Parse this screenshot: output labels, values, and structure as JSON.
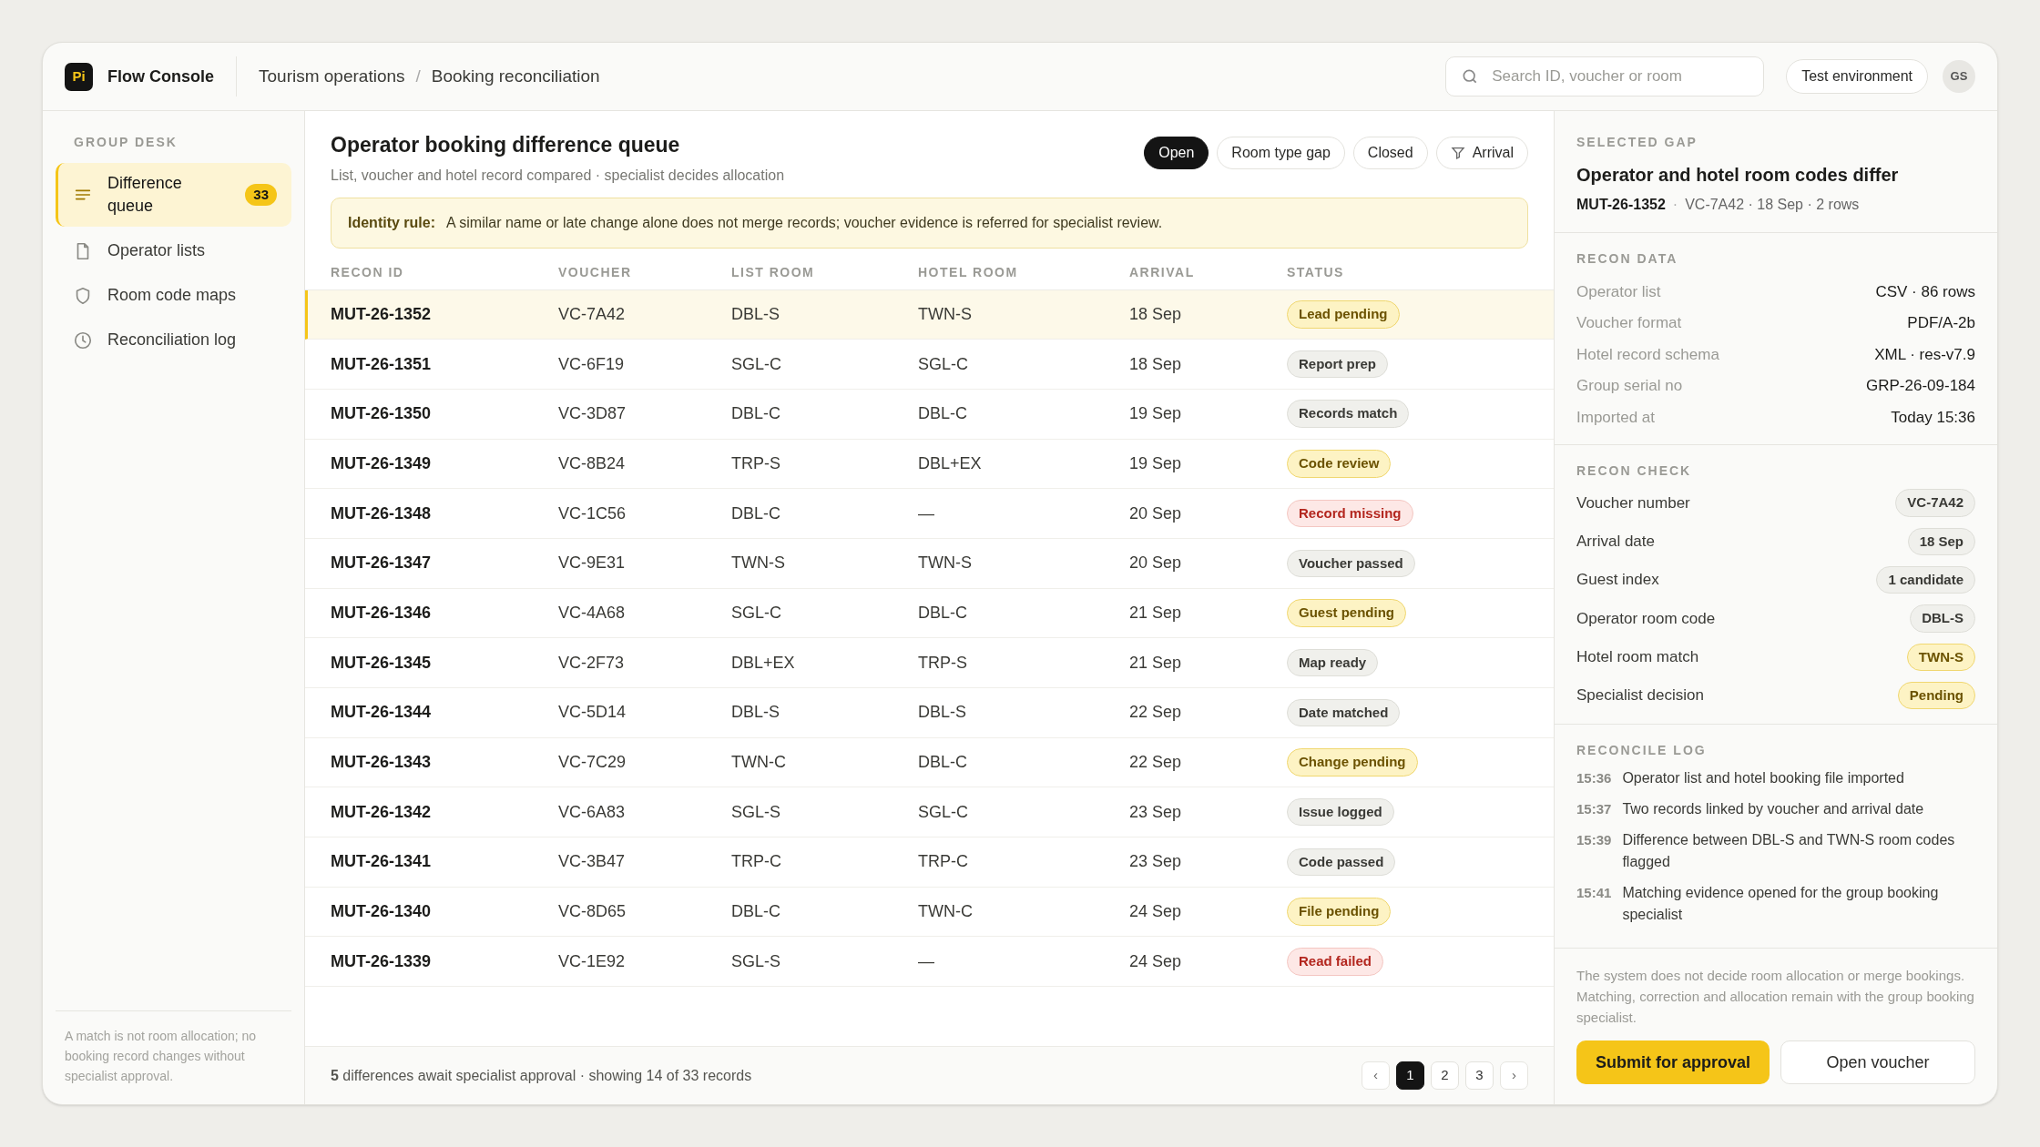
{
  "app": {
    "logo": "Pi",
    "name": "Flow Console"
  },
  "breadcrumb": {
    "items": [
      "Tourism operations",
      "Booking reconciliation"
    ],
    "separator": "/"
  },
  "search": {
    "placeholder": "Search ID, voucher or room"
  },
  "environment": "Test environment",
  "user": {
    "initials": "GS"
  },
  "sidebar": {
    "heading": "GROUP DESK",
    "items": [
      {
        "label": "Difference queue",
        "kind": "lines",
        "badge": "33",
        "selected": true
      },
      {
        "label": "Operator lists",
        "kind": "file",
        "selected": false
      },
      {
        "label": "Room code maps",
        "kind": "shield",
        "selected": false
      },
      {
        "label": "Reconciliation log",
        "kind": "clock",
        "selected": false
      }
    ],
    "note": "A match is not room allocation; no booking record changes without specialist approval."
  },
  "queue": {
    "title": "Operator booking difference queue",
    "subtitle": "List, voucher and hotel record compared · specialist decides allocation",
    "filters": [
      {
        "label": "Open",
        "selected": true
      },
      {
        "label": "Room type gap",
        "selected": false
      },
      {
        "label": "Closed",
        "selected": false
      },
      {
        "label": "Arrival",
        "selected": false,
        "kind": "filter"
      }
    ],
    "rule": {
      "label": "Identity rule:",
      "text": "A similar name or late change alone does not merge records; voucher evidence is referred for specialist review."
    },
    "columns": [
      "RECON ID",
      "VOUCHER",
      "LIST ROOM",
      "HOTEL ROOM",
      "ARRIVAL",
      "STATUS"
    ],
    "rows": [
      {
        "id": "MUT-26-1352",
        "voucher": "VC-7A42",
        "list_room": "DBL-S",
        "hotel_room": "TWN-S",
        "arrival": "18 Sep",
        "status": "Lead pending",
        "kind": "pending",
        "selected": true
      },
      {
        "id": "MUT-26-1351",
        "voucher": "VC-6F19",
        "list_room": "SGL-C",
        "hotel_room": "SGL-C",
        "arrival": "18 Sep",
        "status": "Report prep",
        "kind": "neutral",
        "selected": false
      },
      {
        "id": "MUT-26-1350",
        "voucher": "VC-3D87",
        "list_room": "DBL-C",
        "hotel_room": "DBL-C",
        "arrival": "19 Sep",
        "status": "Records match",
        "kind": "neutral",
        "selected": false
      },
      {
        "id": "MUT-26-1349",
        "voucher": "VC-8B24",
        "list_room": "TRP-S",
        "hotel_room": "DBL+EX",
        "arrival": "19 Sep",
        "status": "Code review",
        "kind": "pending",
        "selected": false
      },
      {
        "id": "MUT-26-1348",
        "voucher": "VC-1C56",
        "list_room": "DBL-C",
        "hotel_room": "—",
        "arrival": "20 Sep",
        "status": "Record missing",
        "kind": "error",
        "selected": false
      },
      {
        "id": "MUT-26-1347",
        "voucher": "VC-9E31",
        "list_room": "TWN-S",
        "hotel_room": "TWN-S",
        "arrival": "20 Sep",
        "status": "Voucher passed",
        "kind": "neutral",
        "selected": false
      },
      {
        "id": "MUT-26-1346",
        "voucher": "VC-4A68",
        "list_room": "SGL-C",
        "hotel_room": "DBL-C",
        "arrival": "21 Sep",
        "status": "Guest pending",
        "kind": "pending",
        "selected": false
      },
      {
        "id": "MUT-26-1345",
        "voucher": "VC-2F73",
        "list_room": "DBL+EX",
        "hotel_room": "TRP-S",
        "arrival": "21 Sep",
        "status": "Map ready",
        "kind": "neutral",
        "selected": false
      },
      {
        "id": "MUT-26-1344",
        "voucher": "VC-5D14",
        "list_room": "DBL-S",
        "hotel_room": "DBL-S",
        "arrival": "22 Sep",
        "status": "Date matched",
        "kind": "neutral",
        "selected": false
      },
      {
        "id": "MUT-26-1343",
        "voucher": "VC-7C29",
        "list_room": "TWN-C",
        "hotel_room": "DBL-C",
        "arrival": "22 Sep",
        "status": "Change pending",
        "kind": "pending",
        "selected": false
      },
      {
        "id": "MUT-26-1342",
        "voucher": "VC-6A83",
        "list_room": "SGL-S",
        "hotel_room": "SGL-C",
        "arrival": "23 Sep",
        "status": "Issue logged",
        "kind": "neutral",
        "selected": false
      },
      {
        "id": "MUT-26-1341",
        "voucher": "VC-3B47",
        "list_room": "TRP-C",
        "hotel_room": "TRP-C",
        "arrival": "23 Sep",
        "status": "Code passed",
        "kind": "neutral",
        "selected": false
      },
      {
        "id": "MUT-26-1340",
        "voucher": "VC-8D65",
        "list_room": "DBL-C",
        "hotel_room": "TWN-C",
        "arrival": "24 Sep",
        "status": "File pending",
        "kind": "pending",
        "selected": false
      },
      {
        "id": "MUT-26-1339",
        "voucher": "VC-1E92",
        "list_room": "SGL-S",
        "hotel_room": "—",
        "arrival": "24 Sep",
        "status": "Read failed",
        "kind": "error",
        "selected": false
      }
    ],
    "footer": "**5** differences await specialist approval · showing 14 of 33 records",
    "pages": [
      {
        "label": "‹",
        "kind": "arrow",
        "selected": false
      },
      {
        "label": "1",
        "kind": "page",
        "selected": true
      },
      {
        "label": "2",
        "kind": "page",
        "selected": false
      },
      {
        "label": "3",
        "kind": "page",
        "selected": false
      },
      {
        "label": "›",
        "kind": "arrow",
        "selected": false
      }
    ]
  },
  "detail": {
    "heading": "SELECTED GAP",
    "title": "Operator and hotel room codes differ",
    "id": "MUT-26-1352",
    "separator": "·",
    "meta": "VC-7A42 · 18 Sep · 2 rows",
    "data_heading": "RECON DATA",
    "data": [
      {
        "label": "Operator list",
        "value": "CSV · 86 rows"
      },
      {
        "label": "Voucher format",
        "value": "PDF/A-2b"
      },
      {
        "label": "Hotel record schema",
        "value": "XML · res-v7.9"
      },
      {
        "label": "Group serial no",
        "value": "GRP-26-09-184"
      },
      {
        "label": "Imported at",
        "value": "Today 15:36"
      }
    ],
    "check_heading": "RECON CHECK",
    "checks": [
      {
        "label": "Voucher number",
        "value": "VC-7A42",
        "kind": "neutral"
      },
      {
        "label": "Arrival date",
        "value": "18 Sep",
        "kind": "neutral"
      },
      {
        "label": "Guest index",
        "value": "1 candidate",
        "kind": "neutral"
      },
      {
        "label": "Operator room code",
        "value": "DBL-S",
        "kind": "neutral"
      },
      {
        "label": "Hotel room match",
        "value": "TWN-S",
        "kind": "pending"
      },
      {
        "label": "Specialist decision",
        "value": "Pending",
        "kind": "pending"
      }
    ],
    "log_heading": "RECONCILE LOG",
    "log": [
      {
        "time": "15:36",
        "text": "Operator list and hotel booking file imported"
      },
      {
        "time": "15:37",
        "text": "Two records linked by voucher and arrival date"
      },
      {
        "time": "15:39",
        "text": "Difference between DBL-S and TWN-S room codes flagged"
      },
      {
        "time": "15:41",
        "text": "Matching evidence opened for the group booking specialist"
      }
    ],
    "note": "The system does not decide room allocation or merge bookings. Matching, correction and allocation remain with the group booking specialist.",
    "primary_button": "Submit for approval",
    "secondary_button": "Open voucher"
  }
}
